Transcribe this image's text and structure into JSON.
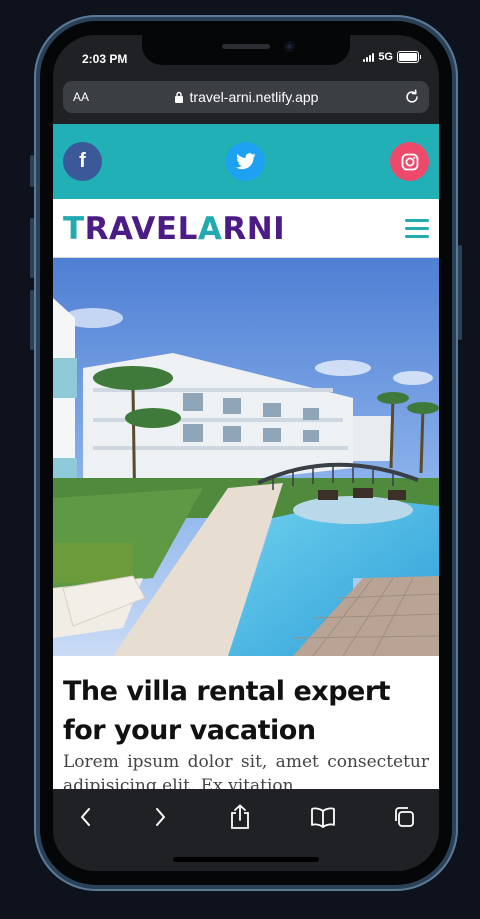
{
  "status": {
    "time": "2:03 PM",
    "network": "5G"
  },
  "browser": {
    "aa_label": "AA",
    "url": "travel-arni.netlify.app"
  },
  "social": {
    "facebook": "f",
    "twitter": "twitter",
    "instagram": "instagram"
  },
  "brand": {
    "logo_accent": "T",
    "logo_rest_1": "RAVEL",
    "logo_accent_2": "A",
    "logo_rest_2": "RNI"
  },
  "hero": {
    "headline": "The villa rental expert for your vacation",
    "body": "Lorem ipsum dolor sit, amet consectetur adipisicing elit. Ex vitation"
  },
  "toolbar": {
    "back": "chevron-left-icon",
    "forward": "chevron-right-icon",
    "share": "share-icon",
    "bookmarks": "book-icon",
    "tabs": "tabs-icon"
  },
  "colors": {
    "teal": "#21b0b6",
    "purple": "#4b1b86",
    "facebook": "#3b5998",
    "twitter": "#1da1f2",
    "instagram": "#ed4a6b"
  }
}
